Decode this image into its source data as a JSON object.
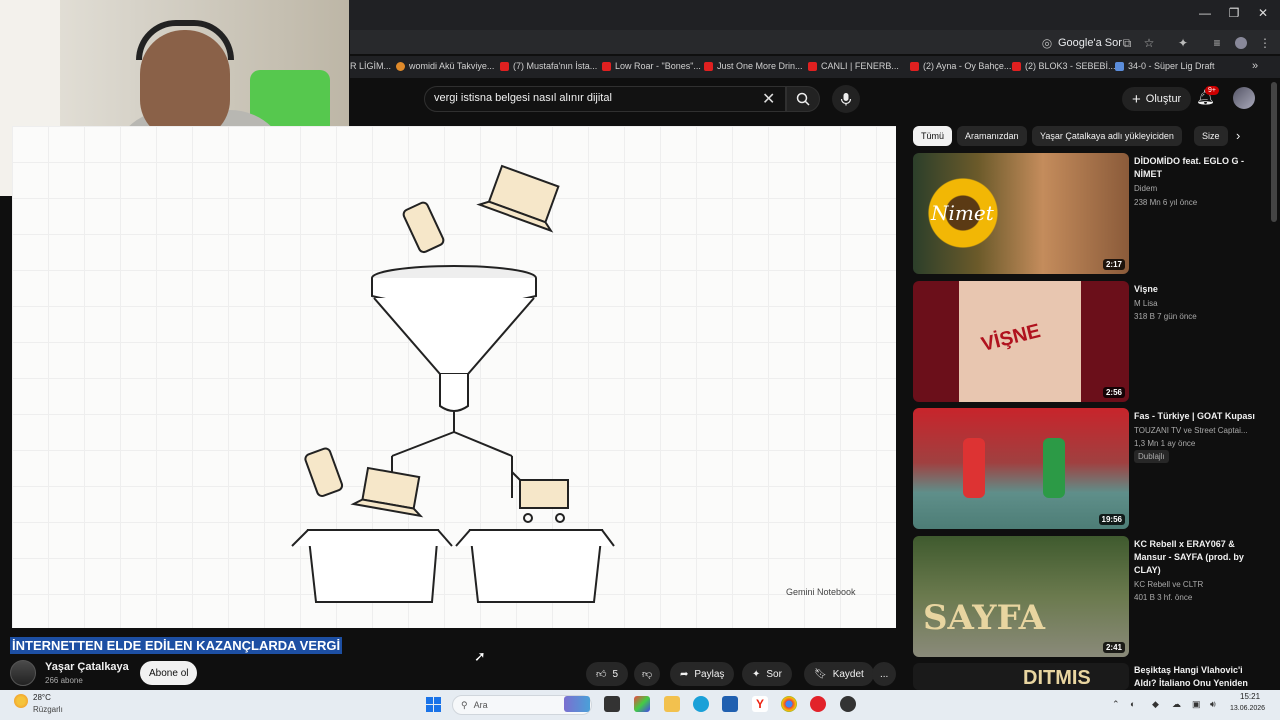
{
  "window": {
    "minimize": "—",
    "restore": "❐",
    "close": "✕"
  },
  "omnibar": {
    "google_lens_label": "Google'a Sor"
  },
  "bookmarks": [
    {
      "label": "R LİGİM...",
      "color": "none"
    },
    {
      "label": "womidi Akü Takviye...",
      "color": "orange"
    },
    {
      "label": "(7) Mustafa'nın İsta...",
      "color": "red"
    },
    {
      "label": "Low Roar - \"Bones\"...",
      "color": "red"
    },
    {
      "label": "Just One More Drin...",
      "color": "red"
    },
    {
      "label": "CANLI | FENERB...",
      "color": "red"
    },
    {
      "label": "(2) Ayna - Oy Bahçe...",
      "color": "red"
    },
    {
      "label": "(2) BLOK3 - SEBEBİ...",
      "color": "red"
    },
    {
      "label": "34-0 - Süper Lig Draft",
      "color": "blue"
    }
  ],
  "search": {
    "query": "vergi istisna belgesi nasıl alınır dijital"
  },
  "header": {
    "create_label": "Oluştur",
    "notif_badge": "9+"
  },
  "player": {
    "watermark": "Gemini Notebook"
  },
  "video": {
    "title": "İNTERNETTEN ELDE EDİLEN KAZANÇLARDA VERGİ",
    "channel": "Yaşar Çatalkaya",
    "subscribers": "266 abone",
    "subscribe_label": "Abone ol",
    "likes": "5",
    "share_label": "Paylaş",
    "ask_label": "Sor",
    "save_label": "Kaydet",
    "more_label": "..."
  },
  "chips": [
    "Tümü",
    "Aramanızdan",
    "Yaşar Çatalkaya adlı yükleyiciden",
    "Size"
  ],
  "recommendations": [
    {
      "title": "DİDOMİDO feat. EGLO G - NİMET",
      "channel": "Didem",
      "stats": "238 Mn   6 yıl önce",
      "duration": "2:17",
      "thumb_text": "Nimet"
    },
    {
      "title": "Vişne",
      "channel": "M Lisa",
      "stats": "318 B   7 gün önce",
      "duration": "2:56",
      "thumb_text": "VİŞNE"
    },
    {
      "title": "Fas - Türkiye | GOAT Kupası",
      "channel": "TOUZANI TV",
      "channel_extra": "ve Street Captai...",
      "stats": "1,3 Mn   1 ay önce",
      "badge": "Dublajlı",
      "duration": "19:56"
    },
    {
      "title": "KC Rebell x ERAY067 & Mansur - SAYFA (prod. by CLAY)",
      "channel": "KC Rebell",
      "channel_extra": "ve CLTR",
      "stats": "401 B   3 hf. önce",
      "duration": "2:41",
      "thumb_text": "SAYFA"
    },
    {
      "title": "Beşiktaş Hangi Vlahovic'i Aldı? İtaliano Onu Yeniden",
      "thumb_text": "DITMIS"
    }
  ],
  "taskbar": {
    "weather_temp": "28°C",
    "weather_text": "Rüzgarlı",
    "search_placeholder": "Ara",
    "time": "15:21",
    "date": "13.06.2026"
  },
  "colors": {
    "title_highlight": "#1d4fa3",
    "youtube_red": "#cc0000"
  }
}
